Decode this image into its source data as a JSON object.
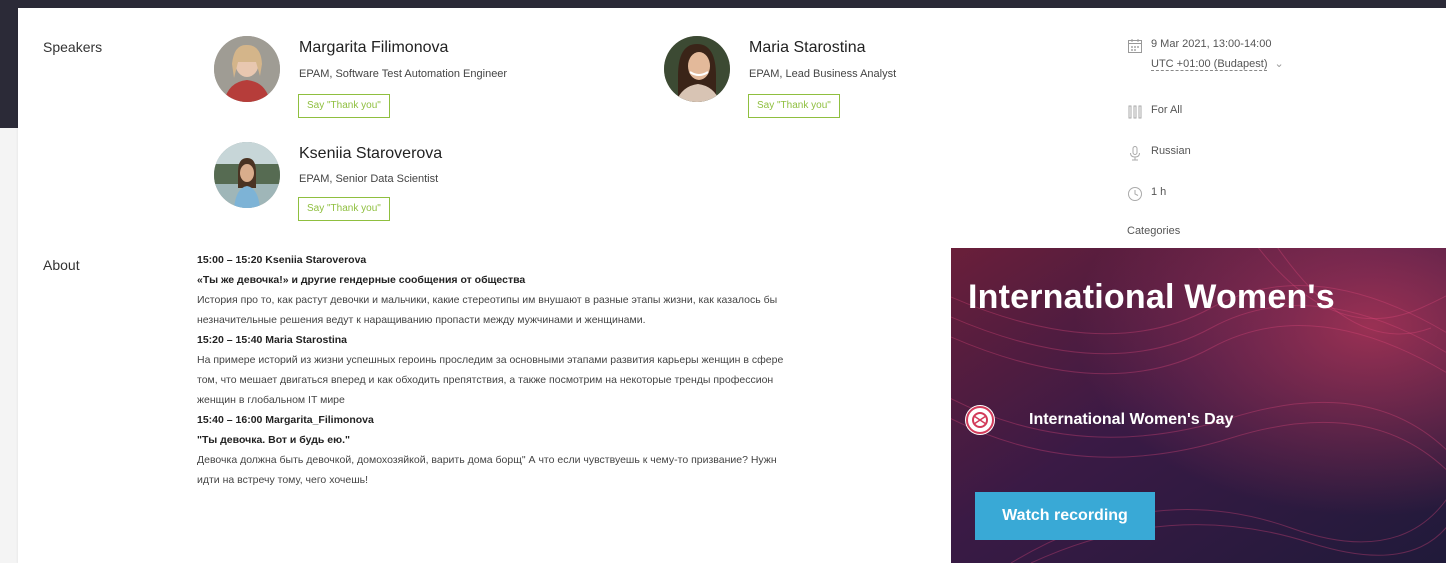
{
  "speakers_section": {
    "label": "Speakers",
    "speakers": [
      {
        "name": "Margarita Filimonova",
        "role": "EPAM, Software Test Automation Engineer",
        "thanks_label": "Say \"Thank you\""
      },
      {
        "name": "Maria Starostina",
        "role": "EPAM, Lead Business Analyst",
        "thanks_label": "Say \"Thank you\""
      },
      {
        "name": "Kseniia Staroverova",
        "role": "EPAM, Senior Data Scientist",
        "thanks_label": "Say \"Thank you\""
      }
    ]
  },
  "event_meta": {
    "date": "9 Mar 2021, 13:00-14:00",
    "timezone": "UTC +01:00 (Budapest)",
    "audience": "For All",
    "language": "Russian",
    "duration": "1 h",
    "categories_label": "Categories"
  },
  "about_section": {
    "label": "About",
    "lines": [
      {
        "text": "15:00 – 15:20 Kseniia Staroverova",
        "bold": true
      },
      {
        "text": "«Ты же девочка!» и другие гендерные сообщения от общества",
        "bold": true
      },
      {
        "text": "История про то, как растут девочки и мальчики, какие стереотипы им внушают в разные этапы жизни, как казалось бы",
        "bold": false
      },
      {
        "text": "незначительные решения ведут к наращиванию пропасти между мужчинами и женщинами.",
        "bold": false
      },
      {
        "text": "15:20 – 15:40 Maria Starostina",
        "bold": true
      },
      {
        "text": "На примере историй из жизни успешных героинь проследим за основными этапами развития карьеры женщин в сфере",
        "bold": false
      },
      {
        "text": "том, что мешает двигаться вперед и как обходить препятствия, а также посмотрим на некоторые тренды профессион",
        "bold": false
      },
      {
        "text": "женщин в глобальном IT мире",
        "bold": false
      },
      {
        "text": "15:40 – 16:00 Margarita_Filimonova",
        "bold": true
      },
      {
        "text": "\"Ты девочка. Вот и будь ею.\"",
        "bold": true
      },
      {
        "text": "Девочка должна быть девочкой, домохозяйкой, варить дома борщ\" А что если чувствуешь к чему-то призвание? Нужн",
        "bold": false
      },
      {
        "text": "идти на встречу тому, чего хочешь!",
        "bold": false
      }
    ]
  },
  "promo": {
    "title": "International Women's",
    "community_name": "International Women's Day",
    "watch_label": "Watch recording"
  },
  "colors": {
    "header_dark": "#2b2a37",
    "accent_green": "#8fbf3f",
    "button_blue": "#39a9d6",
    "promo_bg": "#2f1c45"
  }
}
